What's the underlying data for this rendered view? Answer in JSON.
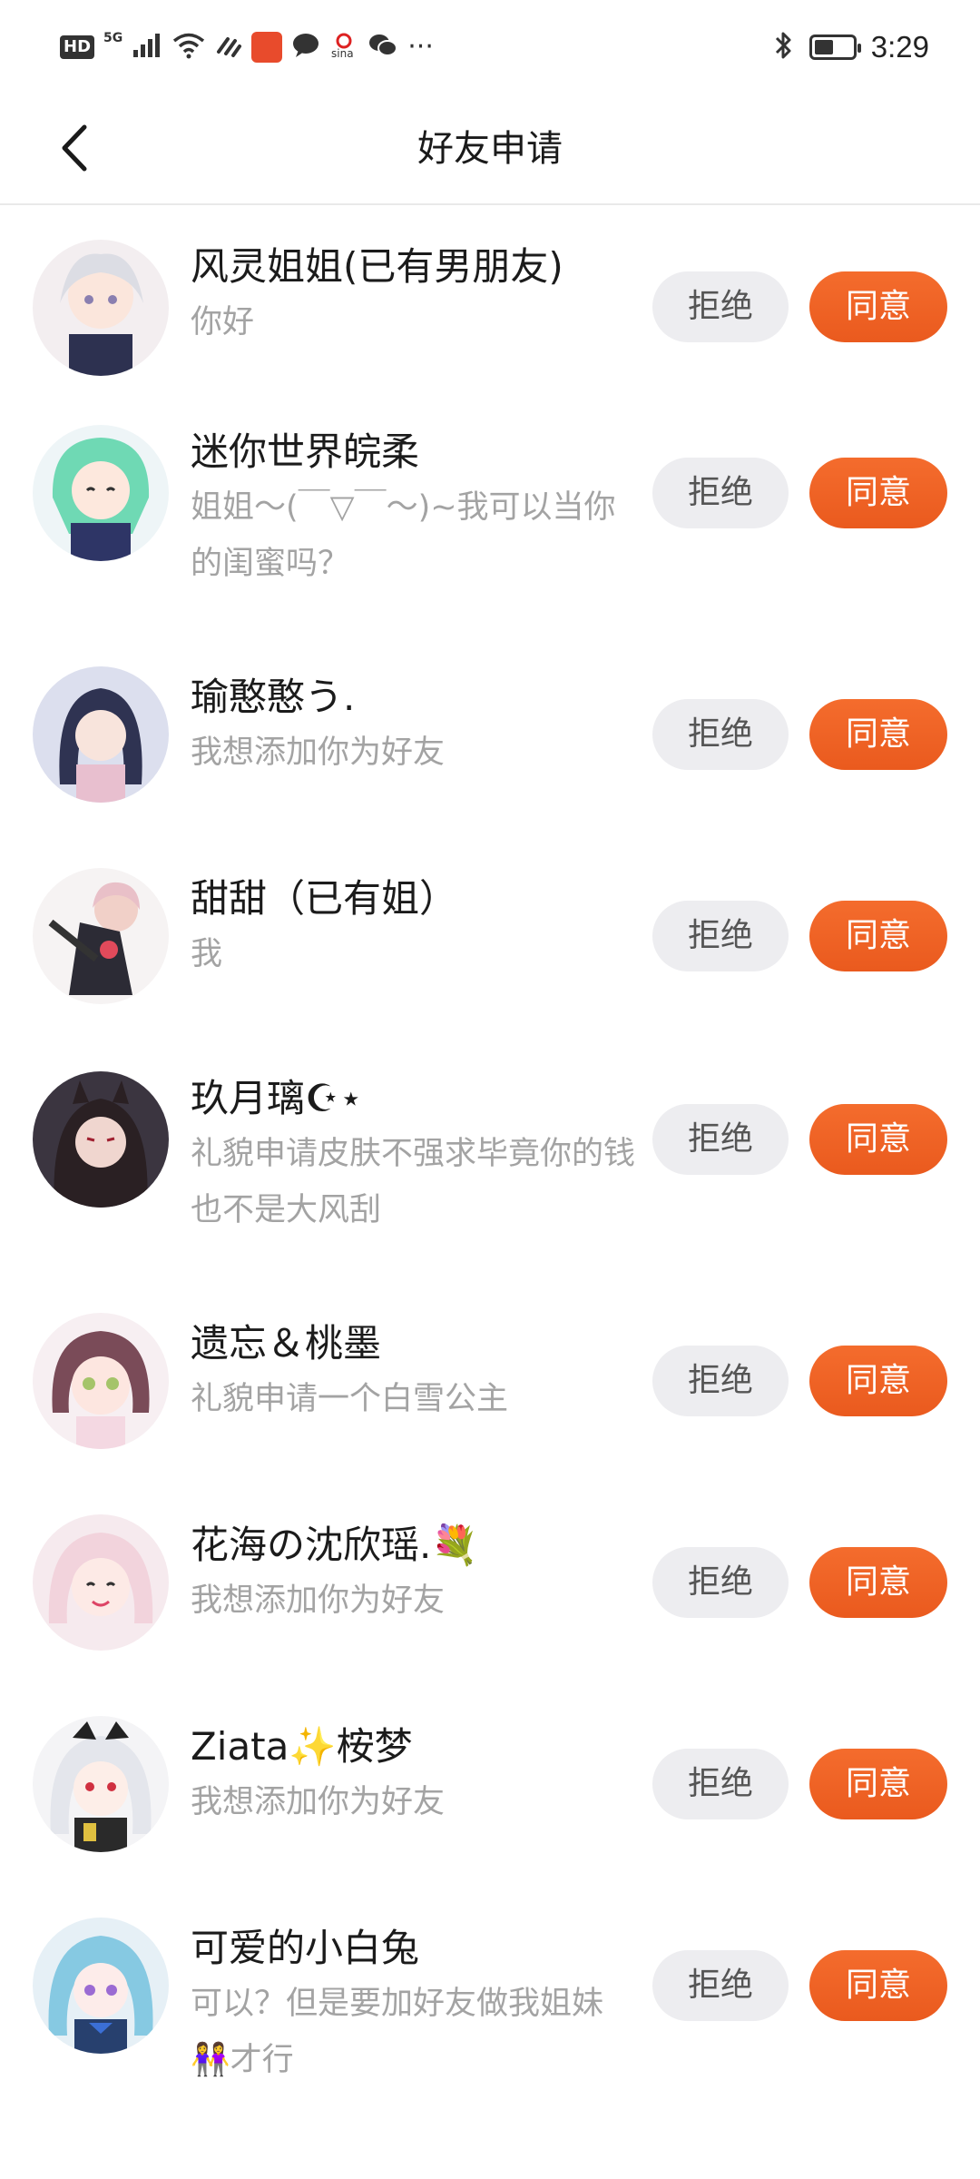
{
  "status_bar": {
    "hd": "HD",
    "network": "5G",
    "time": "3:29",
    "battery_level": 0.5,
    "icons": [
      "signal-icon",
      "wifi-icon",
      "nfc-icon",
      "app-icon",
      "message-icon",
      "sina-icon",
      "wechat-icon",
      "more-icon",
      "bluetooth-icon",
      "battery-icon"
    ]
  },
  "header": {
    "title": "好友申请",
    "back_icon": "chevron-left-icon"
  },
  "buttons": {
    "reject_label": "拒绝",
    "accept_label": "同意"
  },
  "colors": {
    "accent": "#f0622a",
    "reject_bg": "#ededf0",
    "secondary_text": "#a3a3a3"
  },
  "requests": [
    {
      "name": "风灵姐姐(已有男朋友)",
      "message": "你好"
    },
    {
      "name": "迷你世界皖柔",
      "message": "姐姐～(￣▽￣～)~我可以当你的闺蜜吗？"
    },
    {
      "name": "瑜憨憨う.",
      "message": "我想添加你为好友"
    },
    {
      "name": "甜甜（已有姐）",
      "message": "我"
    },
    {
      "name": "玖月璃☪⋆",
      "message": "礼貌申请皮肤不强求毕竟你的钱也不是大风刮"
    },
    {
      "name": "遗忘＆桃墨",
      "message": "礼貌申请一个白雪公主"
    },
    {
      "name": "花海の沈欣瑶.💐",
      "message": "我想添加你为好友"
    },
    {
      "name": "Ziata✨桉梦",
      "message": "我想添加你为好友"
    },
    {
      "name": "可爱的小白兔",
      "message": "可以？但是要加好友做我姐妹👭才行"
    }
  ]
}
